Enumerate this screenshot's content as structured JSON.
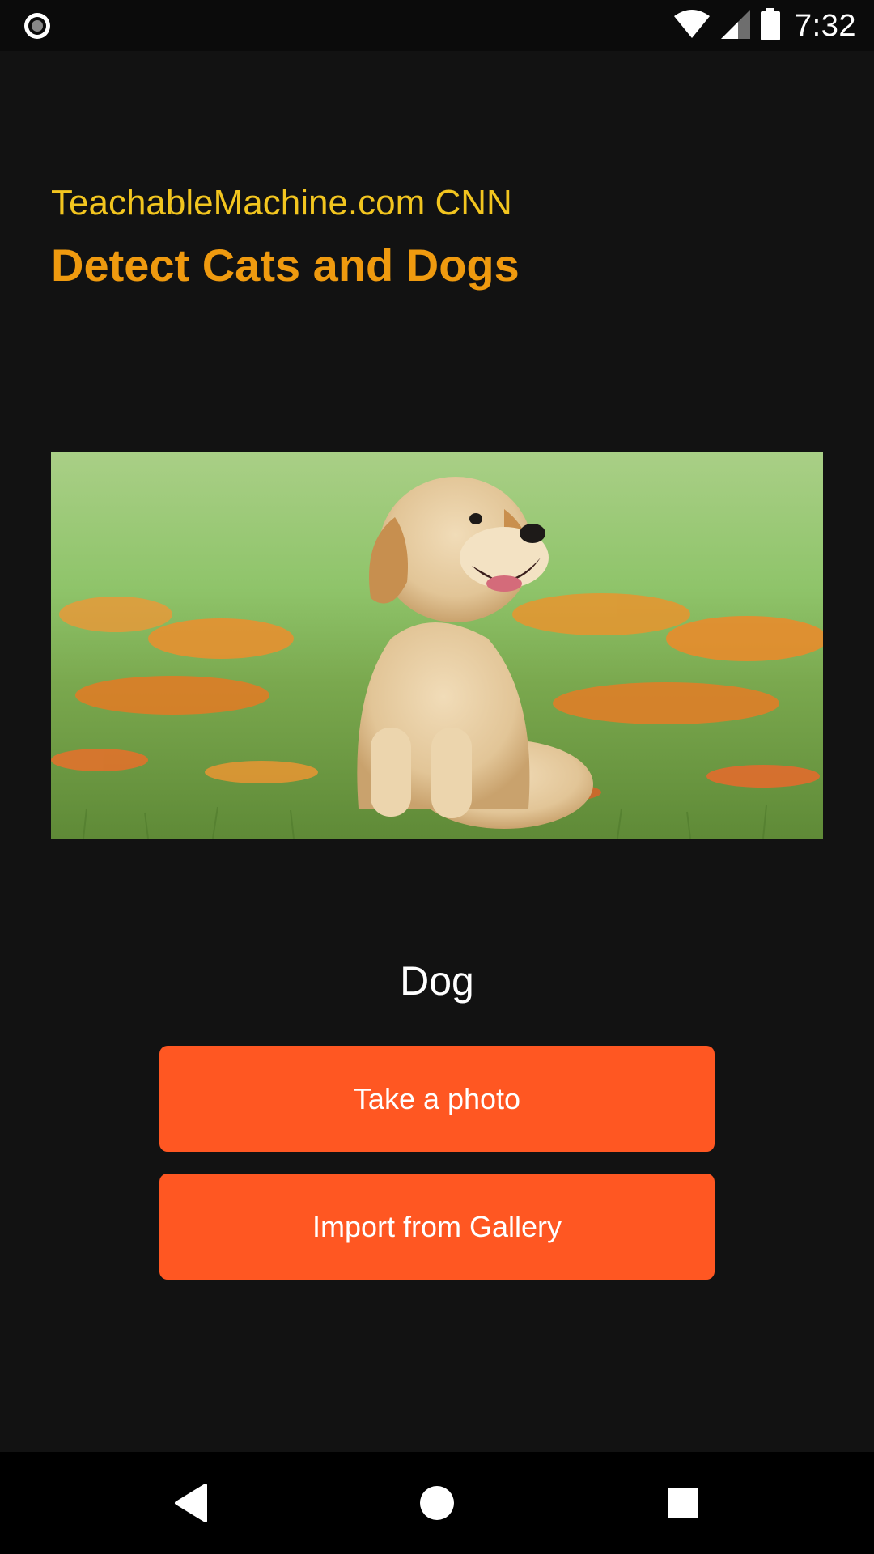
{
  "status_bar": {
    "time": "7:32",
    "icons": [
      "screen-record-icon",
      "wifi-icon",
      "cell-signal-icon",
      "battery-icon"
    ]
  },
  "header": {
    "subtitle": "TeachableMachine.com CNN",
    "title": "Detect Cats and Dogs"
  },
  "photo": {
    "subject": "golden retriever puppy sitting in grass with orange flowers"
  },
  "result": {
    "label": "Dog"
  },
  "buttons": {
    "take_photo": "Take a photo",
    "import_gallery": "Import from Gallery"
  },
  "nav_bar": {
    "icons": [
      "back-icon",
      "home-icon",
      "recents-icon"
    ]
  },
  "colors": {
    "background": "#121212",
    "subtitle": "#f2c51f",
    "title": "#ef9a0f",
    "button": "#ff5722"
  }
}
